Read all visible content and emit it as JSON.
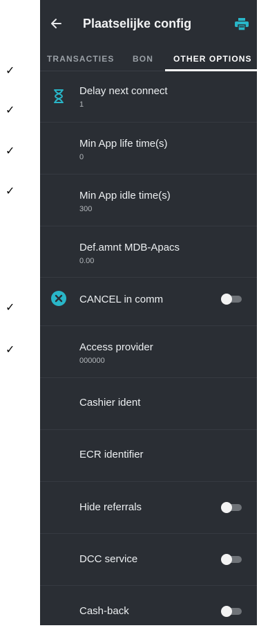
{
  "annotations": {
    "check_mark": "✓"
  },
  "appbar": {
    "title": "Plaatselijke config",
    "back_icon": "arrow-left-icon",
    "print_icon": "printer-icon"
  },
  "tabs": [
    {
      "label": "TRANSACTIES",
      "active": false
    },
    {
      "label": "BON",
      "active": false
    },
    {
      "label": "OTHER OPTIONS",
      "active": true
    }
  ],
  "settings": [
    {
      "title": "Delay next connect",
      "value": "1",
      "icon": "hourglass-icon"
    },
    {
      "title": "Min App life time(s)",
      "value": "0"
    },
    {
      "title": "Min App idle time(s)",
      "value": "300"
    },
    {
      "title": "Def.amnt MDB-Apacs",
      "value": "0.00"
    },
    {
      "title": "CANCEL in comm",
      "icon": "cancel-circle-icon",
      "toggle": false
    },
    {
      "title": "Access provider",
      "value": "000000"
    },
    {
      "title": "Cashier ident"
    },
    {
      "title": "ECR identifier"
    },
    {
      "title": "Hide referrals",
      "toggle": false
    },
    {
      "title": "DCC service",
      "toggle": false
    },
    {
      "title": "Cash-back",
      "toggle": false
    }
  ],
  "colors": {
    "background": "#2a2e34",
    "accent": "#29b6c8",
    "text": "#e9eaec",
    "toggle_off_track": "#6f7378"
  }
}
